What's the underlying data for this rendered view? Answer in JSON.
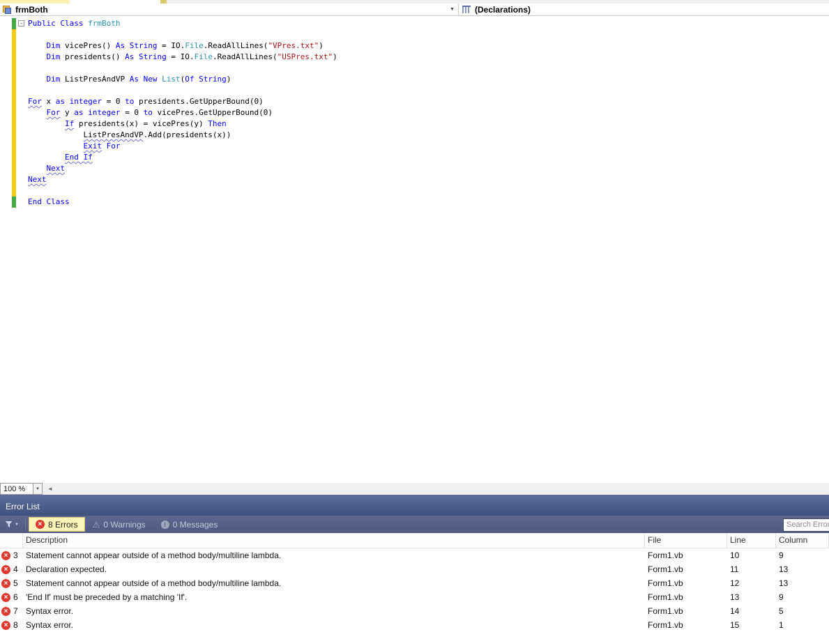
{
  "top": {
    "nav_left": {
      "label": "frmBoth"
    },
    "nav_right": {
      "label": "(Declarations)"
    }
  },
  "editor": {
    "zoom_value": "100 %",
    "code_lines": [
      {
        "status": "green",
        "collapse": true,
        "tokens": [
          [
            "kw",
            "Public Class "
          ],
          [
            "type",
            "frmBoth"
          ]
        ]
      },
      {
        "status": "yellow",
        "tokens": []
      },
      {
        "status": "yellow",
        "tokens": [
          [
            "pl",
            "    "
          ],
          [
            "kw",
            "Dim"
          ],
          [
            "pl",
            " vicePres() "
          ],
          [
            "kw",
            "As String"
          ],
          [
            "pl",
            " = IO."
          ],
          [
            "type",
            "File"
          ],
          [
            "pl",
            ".ReadAllLines("
          ],
          [
            "str",
            "\"VPres.txt\""
          ],
          [
            "pl",
            ")"
          ]
        ]
      },
      {
        "status": "yellow",
        "tokens": [
          [
            "pl",
            "    "
          ],
          [
            "kw",
            "Dim"
          ],
          [
            "pl",
            " presidents() "
          ],
          [
            "kw",
            "As String"
          ],
          [
            "pl",
            " = IO."
          ],
          [
            "type",
            "File"
          ],
          [
            "pl",
            ".ReadAllLines("
          ],
          [
            "str",
            "\"USPres.txt\""
          ],
          [
            "pl",
            ")"
          ]
        ]
      },
      {
        "status": "yellow",
        "tokens": []
      },
      {
        "status": "yellow",
        "tokens": [
          [
            "pl",
            "    "
          ],
          [
            "kw",
            "Dim"
          ],
          [
            "pl",
            " ListPresAndVP "
          ],
          [
            "kw",
            "As New "
          ],
          [
            "type",
            "List"
          ],
          [
            "pl",
            "("
          ],
          [
            "kw",
            "Of String"
          ],
          [
            "pl",
            ")"
          ]
        ]
      },
      {
        "status": "yellow",
        "tokens": []
      },
      {
        "status": "yellow",
        "tokens": [
          [
            "kw sq",
            "For"
          ],
          [
            "pl",
            " x "
          ],
          [
            "kw",
            "as integer"
          ],
          [
            "pl",
            " = 0 "
          ],
          [
            "kw",
            "to"
          ],
          [
            "pl",
            " presidents.GetUpperBound(0)"
          ]
        ]
      },
      {
        "status": "yellow",
        "tokens": [
          [
            "pl",
            "    "
          ],
          [
            "kw sq",
            "For"
          ],
          [
            "pl",
            " y "
          ],
          [
            "kw",
            "as integer"
          ],
          [
            "pl",
            " = 0 "
          ],
          [
            "kw",
            "to"
          ],
          [
            "pl",
            " vicePres.GetUpperBound(0)"
          ]
        ]
      },
      {
        "status": "yellow",
        "tokens": [
          [
            "pl",
            "        "
          ],
          [
            "kw sq",
            "If"
          ],
          [
            "pl",
            " presidents(x) = vicePres(y) "
          ],
          [
            "kw",
            "Then"
          ]
        ]
      },
      {
        "status": "yellow",
        "tokens": [
          [
            "pl",
            "            "
          ],
          [
            "pl sq",
            "ListPresAndVP"
          ],
          [
            "pl",
            ".Add(presidents(x))"
          ]
        ]
      },
      {
        "status": "yellow",
        "tokens": [
          [
            "pl",
            "            "
          ],
          [
            "kw sq",
            "Exit"
          ],
          [
            "kw",
            " For"
          ]
        ]
      },
      {
        "status": "yellow",
        "tokens": [
          [
            "pl",
            "        "
          ],
          [
            "kw sq",
            "End If"
          ]
        ]
      },
      {
        "status": "yellow",
        "tokens": [
          [
            "pl",
            "    "
          ],
          [
            "kw sq",
            "Next"
          ]
        ]
      },
      {
        "status": "yellow",
        "tokens": [
          [
            "kw sq",
            "Next"
          ]
        ]
      },
      {
        "status": "yellow",
        "tokens": []
      },
      {
        "status": "green",
        "tokens": [
          [
            "kw",
            "End Class"
          ]
        ]
      }
    ]
  },
  "error_list": {
    "title": "Error List",
    "toolbar": {
      "errors_label": "8 Errors",
      "warnings_label": "0 Warnings",
      "messages_label": "0 Messages",
      "search_placeholder": "Search Error"
    },
    "columns": {
      "description": "Description",
      "file": "File",
      "line": "Line",
      "column": "Column"
    },
    "rows": [
      {
        "num": "3",
        "description": "Statement cannot appear outside of a method body/multiline lambda.",
        "file": "Form1.vb",
        "line": "10",
        "column": "9"
      },
      {
        "num": "4",
        "description": "Declaration expected.",
        "file": "Form1.vb",
        "line": "11",
        "column": "13"
      },
      {
        "num": "5",
        "description": "Statement cannot appear outside of a method body/multiline lambda.",
        "file": "Form1.vb",
        "line": "12",
        "column": "13"
      },
      {
        "num": "6",
        "description": "'End If' must be preceded by a matching 'If'.",
        "file": "Form1.vb",
        "line": "13",
        "column": "9"
      },
      {
        "num": "7",
        "description": "Syntax error.",
        "file": "Form1.vb",
        "line": "14",
        "column": "5"
      },
      {
        "num": "8",
        "description": "Syntax error.",
        "file": "Form1.vb",
        "line": "15",
        "column": "1"
      }
    ]
  },
  "colors": {
    "keyword": "#0000ff",
    "type_name": "#2b91af",
    "string_literal": "#a31515",
    "squiggle": "#7070cc",
    "change_bar_unsaved": "#f5cc11",
    "change_bar_saved": "#45a945",
    "panel_header_top": "#5d6e9a",
    "panel_header_bottom": "#3f527f",
    "errors_button_bg": "#fcf4b8",
    "error_icon_red": "#dd3a30"
  },
  "glyphs": {
    "dropdown": "▼",
    "collapse": "-",
    "scroll_left": "◄",
    "warning": "⚠",
    "info": "i",
    "error_x": "×"
  }
}
